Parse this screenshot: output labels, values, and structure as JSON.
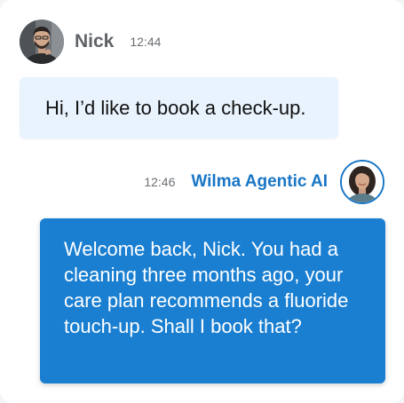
{
  "user": {
    "name": "Nick",
    "time": "12:44",
    "message": "Hi, I’d like to book a check-up."
  },
  "agent": {
    "name": "Wilma Agentic AI",
    "time": "12:46",
    "message": "Welcome back, Nick. You had a cleaning three months ago, your care plan recommends a fluoride touch-up. Shall I book that?"
  },
  "colors": {
    "agent_accent": "#1976c6",
    "agent_bubble": "#1a7fd1",
    "user_bubble": "#e9f3fd"
  }
}
